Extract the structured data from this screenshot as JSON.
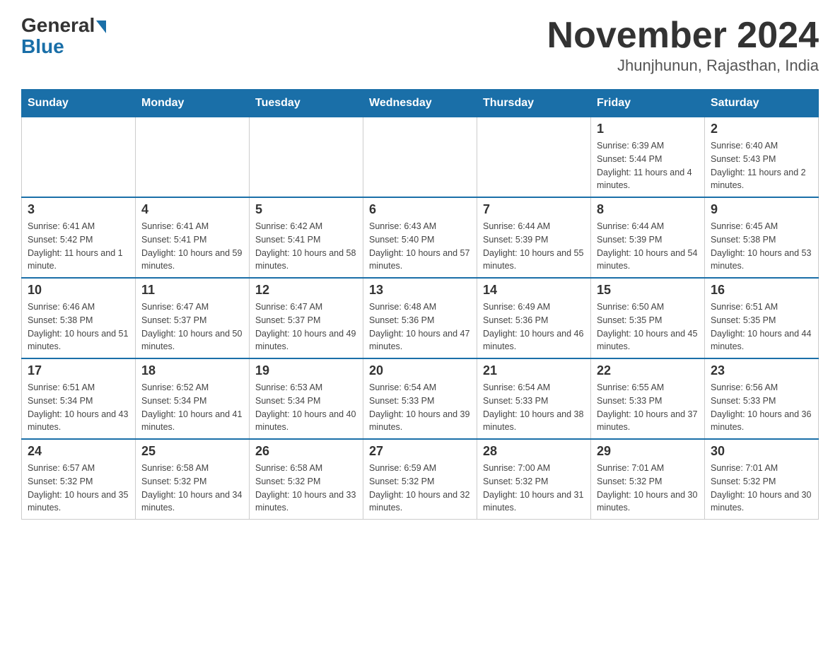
{
  "header": {
    "logo_general": "General",
    "logo_blue": "Blue",
    "month_title": "November 2024",
    "location": "Jhunjhunun, Rajasthan, India"
  },
  "weekdays": [
    "Sunday",
    "Monday",
    "Tuesday",
    "Wednesday",
    "Thursday",
    "Friday",
    "Saturday"
  ],
  "weeks": [
    [
      {
        "day": "",
        "info": ""
      },
      {
        "day": "",
        "info": ""
      },
      {
        "day": "",
        "info": ""
      },
      {
        "day": "",
        "info": ""
      },
      {
        "day": "",
        "info": ""
      },
      {
        "day": "1",
        "info": "Sunrise: 6:39 AM\nSunset: 5:44 PM\nDaylight: 11 hours and 4 minutes."
      },
      {
        "day": "2",
        "info": "Sunrise: 6:40 AM\nSunset: 5:43 PM\nDaylight: 11 hours and 2 minutes."
      }
    ],
    [
      {
        "day": "3",
        "info": "Sunrise: 6:41 AM\nSunset: 5:42 PM\nDaylight: 11 hours and 1 minute."
      },
      {
        "day": "4",
        "info": "Sunrise: 6:41 AM\nSunset: 5:41 PM\nDaylight: 10 hours and 59 minutes."
      },
      {
        "day": "5",
        "info": "Sunrise: 6:42 AM\nSunset: 5:41 PM\nDaylight: 10 hours and 58 minutes."
      },
      {
        "day": "6",
        "info": "Sunrise: 6:43 AM\nSunset: 5:40 PM\nDaylight: 10 hours and 57 minutes."
      },
      {
        "day": "7",
        "info": "Sunrise: 6:44 AM\nSunset: 5:39 PM\nDaylight: 10 hours and 55 minutes."
      },
      {
        "day": "8",
        "info": "Sunrise: 6:44 AM\nSunset: 5:39 PM\nDaylight: 10 hours and 54 minutes."
      },
      {
        "day": "9",
        "info": "Sunrise: 6:45 AM\nSunset: 5:38 PM\nDaylight: 10 hours and 53 minutes."
      }
    ],
    [
      {
        "day": "10",
        "info": "Sunrise: 6:46 AM\nSunset: 5:38 PM\nDaylight: 10 hours and 51 minutes."
      },
      {
        "day": "11",
        "info": "Sunrise: 6:47 AM\nSunset: 5:37 PM\nDaylight: 10 hours and 50 minutes."
      },
      {
        "day": "12",
        "info": "Sunrise: 6:47 AM\nSunset: 5:37 PM\nDaylight: 10 hours and 49 minutes."
      },
      {
        "day": "13",
        "info": "Sunrise: 6:48 AM\nSunset: 5:36 PM\nDaylight: 10 hours and 47 minutes."
      },
      {
        "day": "14",
        "info": "Sunrise: 6:49 AM\nSunset: 5:36 PM\nDaylight: 10 hours and 46 minutes."
      },
      {
        "day": "15",
        "info": "Sunrise: 6:50 AM\nSunset: 5:35 PM\nDaylight: 10 hours and 45 minutes."
      },
      {
        "day": "16",
        "info": "Sunrise: 6:51 AM\nSunset: 5:35 PM\nDaylight: 10 hours and 44 minutes."
      }
    ],
    [
      {
        "day": "17",
        "info": "Sunrise: 6:51 AM\nSunset: 5:34 PM\nDaylight: 10 hours and 43 minutes."
      },
      {
        "day": "18",
        "info": "Sunrise: 6:52 AM\nSunset: 5:34 PM\nDaylight: 10 hours and 41 minutes."
      },
      {
        "day": "19",
        "info": "Sunrise: 6:53 AM\nSunset: 5:34 PM\nDaylight: 10 hours and 40 minutes."
      },
      {
        "day": "20",
        "info": "Sunrise: 6:54 AM\nSunset: 5:33 PM\nDaylight: 10 hours and 39 minutes."
      },
      {
        "day": "21",
        "info": "Sunrise: 6:54 AM\nSunset: 5:33 PM\nDaylight: 10 hours and 38 minutes."
      },
      {
        "day": "22",
        "info": "Sunrise: 6:55 AM\nSunset: 5:33 PM\nDaylight: 10 hours and 37 minutes."
      },
      {
        "day": "23",
        "info": "Sunrise: 6:56 AM\nSunset: 5:33 PM\nDaylight: 10 hours and 36 minutes."
      }
    ],
    [
      {
        "day": "24",
        "info": "Sunrise: 6:57 AM\nSunset: 5:32 PM\nDaylight: 10 hours and 35 minutes."
      },
      {
        "day": "25",
        "info": "Sunrise: 6:58 AM\nSunset: 5:32 PM\nDaylight: 10 hours and 34 minutes."
      },
      {
        "day": "26",
        "info": "Sunrise: 6:58 AM\nSunset: 5:32 PM\nDaylight: 10 hours and 33 minutes."
      },
      {
        "day": "27",
        "info": "Sunrise: 6:59 AM\nSunset: 5:32 PM\nDaylight: 10 hours and 32 minutes."
      },
      {
        "day": "28",
        "info": "Sunrise: 7:00 AM\nSunset: 5:32 PM\nDaylight: 10 hours and 31 minutes."
      },
      {
        "day": "29",
        "info": "Sunrise: 7:01 AM\nSunset: 5:32 PM\nDaylight: 10 hours and 30 minutes."
      },
      {
        "day": "30",
        "info": "Sunrise: 7:01 AM\nSunset: 5:32 PM\nDaylight: 10 hours and 30 minutes."
      }
    ]
  ]
}
